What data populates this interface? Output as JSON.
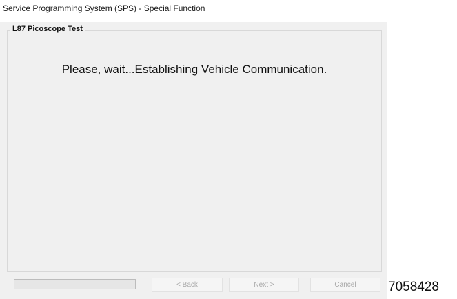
{
  "window": {
    "title": "Service Programming System (SPS) - Special Function"
  },
  "group": {
    "label": "L87 Picoscope Test"
  },
  "message": "Please, wait...Establishing Vehicle Communication.",
  "progress": {
    "value_percent": 0,
    "fill_color": "#06b025"
  },
  "buttons": {
    "back_label": "< Back",
    "next_label": "Next >",
    "cancel_label": "Cancel",
    "enabled": false
  },
  "figure_number": "7058428"
}
